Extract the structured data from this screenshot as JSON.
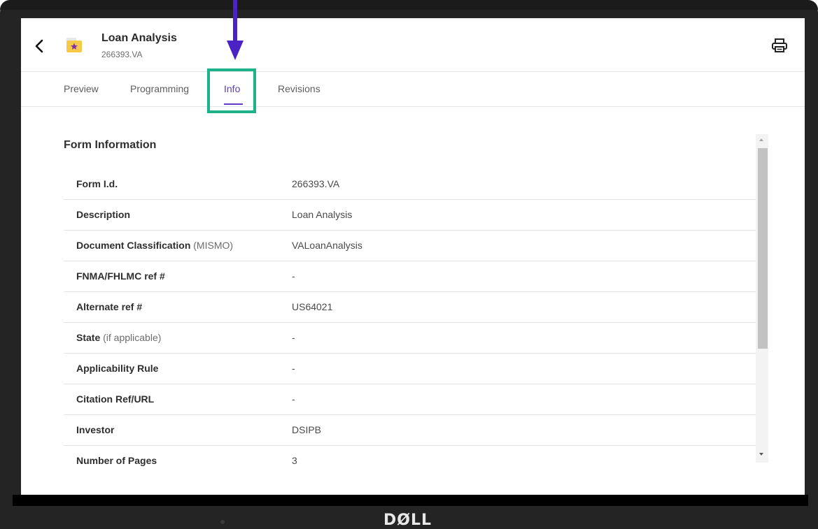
{
  "header": {
    "title": "Loan Analysis",
    "subtitle": "266393.VA"
  },
  "tabs": [
    {
      "label": "Preview",
      "active": false
    },
    {
      "label": "Programming",
      "active": false
    },
    {
      "label": "Info",
      "active": true
    },
    {
      "label": "Revisions",
      "active": false
    }
  ],
  "section_title": "Form Information",
  "rows": [
    {
      "label": "Form I.d.",
      "qualifier": "",
      "value": "266393.VA"
    },
    {
      "label": "Description",
      "qualifier": "",
      "value": "Loan Analysis"
    },
    {
      "label": "Document Classification",
      "qualifier": "(MISMO)",
      "value": "VALoanAnalysis"
    },
    {
      "label": "FNMA/FHLMC ref #",
      "qualifier": "",
      "value": "-"
    },
    {
      "label": "Alternate ref #",
      "qualifier": "",
      "value": "US64021"
    },
    {
      "label": "State",
      "qualifier": "(if applicable)",
      "value": "-"
    },
    {
      "label": "Applicability Rule",
      "qualifier": "",
      "value": "-"
    },
    {
      "label": "Citation Ref/URL",
      "qualifier": "",
      "value": "-"
    },
    {
      "label": "Investor",
      "qualifier": "",
      "value": "DSIPB"
    },
    {
      "label": "Number of Pages",
      "qualifier": "",
      "value": "3"
    }
  ],
  "device": {
    "brand": "DØLL"
  },
  "icons": {
    "back": "chevron-left-icon",
    "form": "folder-star-icon",
    "print": "printer-icon"
  },
  "colors": {
    "accent": "#5d3bc4",
    "highlight": "#1db38a",
    "annotation_arrow": "#4b22c4"
  }
}
